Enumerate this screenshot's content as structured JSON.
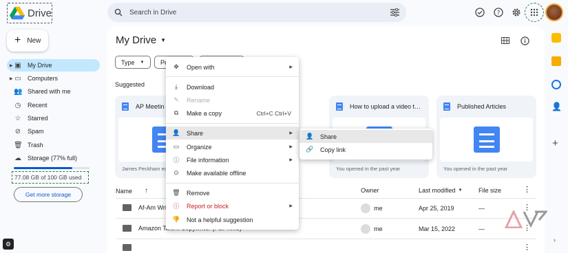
{
  "app": {
    "name": "Drive"
  },
  "search": {
    "placeholder": "Search in Drive"
  },
  "sidebar": {
    "new_label": "New",
    "items": [
      {
        "label": "My Drive",
        "icon": "drive-icon"
      },
      {
        "label": "Computers",
        "icon": "computer-icon"
      },
      {
        "label": "Shared with me",
        "icon": "people-icon"
      },
      {
        "label": "Recent",
        "icon": "clock-icon"
      },
      {
        "label": "Starred",
        "icon": "star-icon"
      },
      {
        "label": "Spam",
        "icon": "spam-icon"
      },
      {
        "label": "Trash",
        "icon": "trash-icon"
      },
      {
        "label": "Storage (77% full)",
        "icon": "cloud-icon"
      }
    ],
    "storage_fraction": 0.77,
    "storage_used": "77.08 GB of 100 GB used",
    "get_storage": "Get more storage"
  },
  "main": {
    "title": "My Drive",
    "chips": [
      "Type",
      "Pe",
      ""
    ],
    "suggested_label": "Suggested",
    "cards": [
      {
        "title": "AP Meetin",
        "subtitle": "James Peckham ed"
      },
      {
        "title": "How to upload a video t…",
        "subtitle": "You opened in the past year"
      },
      {
        "title": "Published Articles",
        "subtitle": "You opened in the past year"
      }
    ],
    "table": {
      "headers": {
        "name": "Name",
        "owner": "Owner",
        "modified": "Last modified",
        "size": "File size"
      },
      "rows": [
        {
          "name": "Af-Am Wri",
          "owner": "me",
          "modified": "Apr 25, 2019",
          "size": "—"
        },
        {
          "name": "Amazon Talent Copywriter (Full Time)",
          "owner": "me",
          "modified": "Mar 15, 2022",
          "size": "—"
        }
      ]
    }
  },
  "context_menu": {
    "items": [
      {
        "label": "Open with",
        "icon": "open-with-icon",
        "submenu": true
      },
      {
        "label": "Download",
        "icon": "download-icon"
      },
      {
        "label": "Rename",
        "icon": "rename-icon",
        "disabled": true
      },
      {
        "label": "Make a copy",
        "icon": "copy-icon",
        "shortcut": "Ctrl+C Ctrl+V"
      },
      {
        "label": "Share",
        "icon": "share-icon",
        "submenu": true,
        "highlighted": true
      },
      {
        "label": "Organize",
        "icon": "folder-icon",
        "submenu": true
      },
      {
        "label": "File information",
        "icon": "info-icon",
        "submenu": true
      },
      {
        "label": "Make available offline",
        "icon": "offline-icon"
      },
      {
        "label": "Remove",
        "icon": "trash-icon"
      },
      {
        "label": "Report or block",
        "icon": "report-icon",
        "submenu": true
      },
      {
        "label": "Not a helpful suggestion",
        "icon": "thumbs-down-icon"
      }
    ]
  },
  "share_submenu": {
    "items": [
      {
        "label": "Share",
        "icon": "share-icon"
      },
      {
        "label": "Copy link",
        "icon": "link-icon"
      }
    ]
  },
  "colors": {
    "accent": "#0b57d0",
    "active_nav": "#c2e7ff",
    "doc_blue": "#4285f4",
    "danger": "#c5221f"
  }
}
